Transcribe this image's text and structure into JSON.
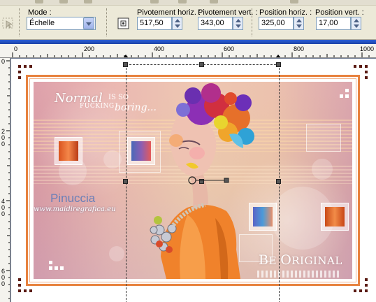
{
  "toolbar": {
    "mode": {
      "label": "Mode :",
      "value": "Échelle"
    },
    "rot_x": {
      "label": "Pivotement horiz. :",
      "value": "517,50"
    },
    "rot_y": {
      "label": "Pivotement vert. :",
      "value": "343,00"
    },
    "pos_x": {
      "label": "Position horiz. :",
      "value": "325,00"
    },
    "pos_y": {
      "label": "Position vert. :",
      "value": "17,00"
    }
  },
  "ruler": {
    "top": [
      "0",
      "200",
      "400",
      "600",
      "800",
      "1000"
    ],
    "left": [
      [
        "0"
      ],
      [
        "2",
        "0",
        "0"
      ],
      [
        "4",
        "0",
        "0"
      ],
      [
        "6",
        "0",
        "0"
      ]
    ]
  },
  "artwork": {
    "normal": "Normal",
    "is_so": "IS SO",
    "fucking": "FUCKING",
    "boring": "boring...",
    "signature": "Pinuccia",
    "url": "www.maidiregrafica.eu",
    "be_original_1": "B",
    "be_original_2": "E ",
    "be_original_3": "O",
    "be_original_4": "RIGINAL"
  },
  "icons": {
    "mode_icon": "pick-tool-icon",
    "pivot_icon": "pivot-point-icon"
  },
  "colors": {
    "frame": "#e7823f",
    "corner_dots": "#5a1a12",
    "title_bar": "#2a5fd8",
    "input_border": "#7f9db9"
  }
}
